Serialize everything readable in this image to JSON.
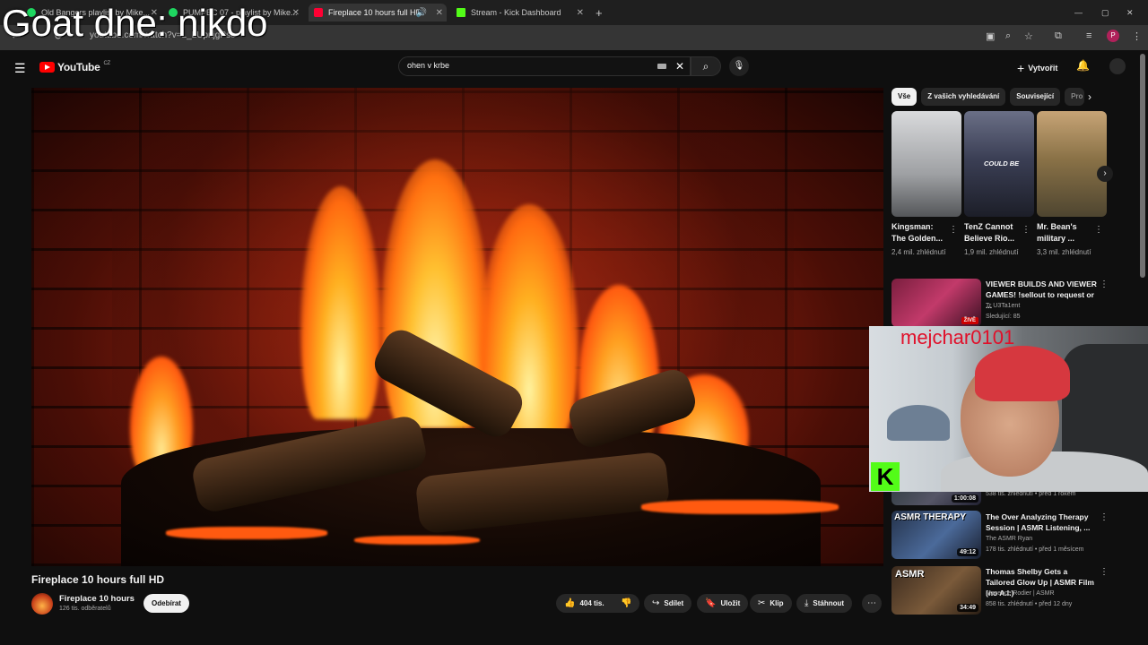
{
  "browser": {
    "tabs": [
      {
        "label": "Old Bangers playlist by Mike...",
        "color": "#1ed760"
      },
      {
        "label": "PUMPEC 07 - playlist by Mike...",
        "color": "#1ed760"
      },
      {
        "label": "Fireplace 10 hours full HD",
        "color": "#ff0033"
      },
      {
        "label": "Stream - Kick Dashboard",
        "color": "#53fc18"
      }
    ],
    "url": "youtube.com/watch?v=L_LUpnjgPso",
    "profile_initial": "P"
  },
  "overlay": {
    "goat_text": "Goat dne: nikdo"
  },
  "youtube": {
    "logo_text": "YouTube",
    "logo_region": "CZ",
    "search_value": "ohen v krbe",
    "create_label": "Vytvořit"
  },
  "video": {
    "title": "Fireplace 10 hours full HD",
    "channel_name": "Fireplace 10 hours",
    "subscribers": "126 tis. odběratelů",
    "subscribe_label": "Odebírat",
    "likes": "404 tis.",
    "share_label": "Sdílet",
    "save_label": "Uložit",
    "clip_label": "Klip",
    "download_label": "Stáhnout"
  },
  "sidebar": {
    "chips": [
      "Vše",
      "Z vašich vyhledávání",
      "Související",
      "Pro"
    ],
    "shorts": [
      {
        "title": "Kingsman: The Golden...",
        "views": "2,4 mil. zhlédnutí"
      },
      {
        "title": "TenZ Cannot Believe Rio...",
        "views": "1,9 mil. zhlédnutí",
        "overlay_text": "COULD BE"
      },
      {
        "title": "Mr. Bean's military ...",
        "views": "3,3 mil. zhlédnutí"
      }
    ],
    "videos": [
      {
        "title": "VIEWER BUILDS AND VIEWER GAMES! !sellout to request or ...",
        "channel": "Tr U3Ta1ent",
        "meta": "Sledující: 85",
        "badge": "ŽIVĚ"
      },
      {
        "title": "",
        "channel": "",
        "meta": "538 tis. zhlédnutí • před 1 rokem",
        "duration": "1:00:08"
      },
      {
        "title": "The Over Analyzing Therapy Session | ASMR Listening, ...",
        "channel": "The ASMR Ryan",
        "meta": "178 tis. zhlédnutí • před 1 měsícem",
        "duration": "49:12",
        "thumb_text": "ASMR THERAPY"
      },
      {
        "title": "Thomas Shelby Gets a Tailored Glow Up | ASMR Film (no A.I.)",
        "channel": "Maxence Rodier | ASMR",
        "meta": "858 tis. zhlédnutí • před 12 dny",
        "duration": "34:49",
        "thumb_text": "ASMR"
      }
    ]
  },
  "webcam": {
    "streamer_name": "mejchar0101",
    "kick_letter": "K"
  }
}
